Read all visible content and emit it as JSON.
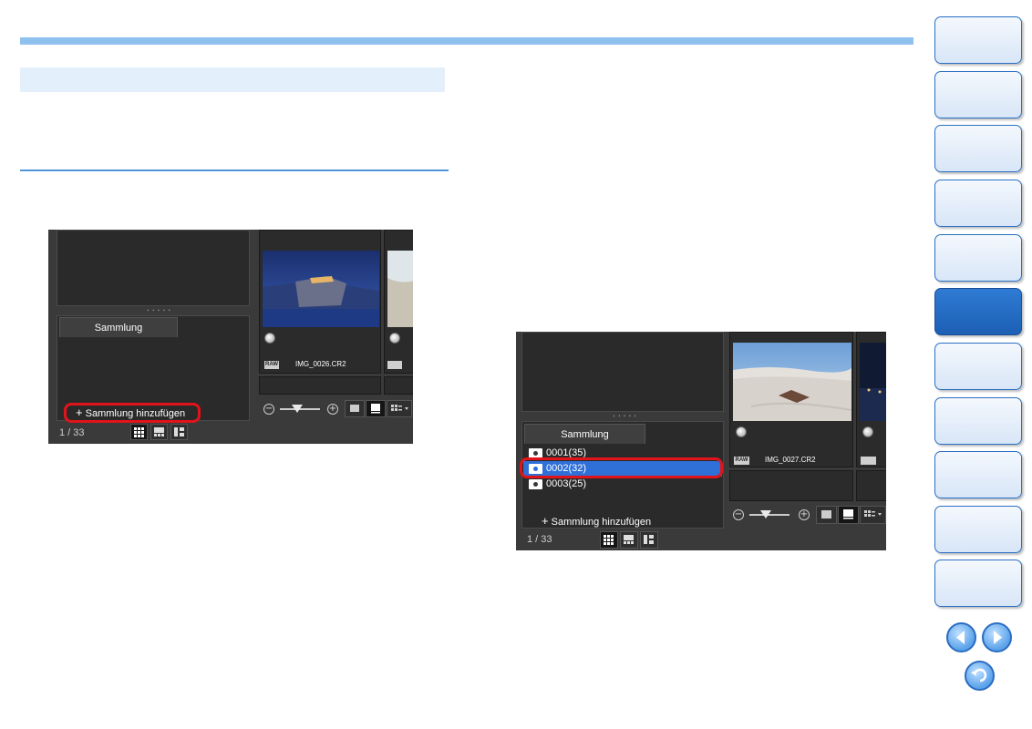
{
  "panel1": {
    "tab_label": "Sammlung",
    "add_label": "Sammlung hinzufügen",
    "counter": "1 / 33",
    "thumb_filename": "IMG_0026.CR2",
    "raw_badge": "RAW"
  },
  "panel2": {
    "tab_label": "Sammlung",
    "collections": [
      {
        "label": "0001(35)"
      },
      {
        "label": "0002(32)"
      },
      {
        "label": "0003(25)"
      }
    ],
    "add_label": "Sammlung hinzufügen",
    "counter": "1 / 33",
    "thumb_filename": "IMG_0027.CR2",
    "raw_badge": "RAW"
  },
  "colors": {
    "accent": "#8fc1ef",
    "selection": "#2f6fd8",
    "highlight_outline": "#e0141a",
    "nav_active": "#1c5fb5"
  },
  "icons": [
    "previous-page-icon",
    "next-page-icon",
    "return-icon",
    "zoom-out-icon",
    "zoom-in-icon",
    "grid-view-icon",
    "preview-view-icon",
    "list-view-icon"
  ]
}
